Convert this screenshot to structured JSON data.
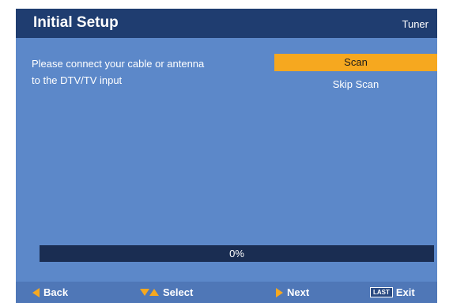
{
  "header": {
    "title": "Initial Setup",
    "section": "Tuner"
  },
  "main": {
    "instruction": "Please connect your cable or antenna to the DTV/TV input"
  },
  "menu": {
    "items": [
      {
        "label": "Scan",
        "selected": true
      },
      {
        "label": "Skip Scan",
        "selected": false
      }
    ]
  },
  "progress": {
    "value": 0,
    "label": "0%"
  },
  "footer": {
    "back_label": "Back",
    "select_label": "Select",
    "next_label": "Next",
    "exit_key": "LAST",
    "exit_label": "Exit"
  },
  "icons": {
    "back": "triangle-left-icon",
    "select": "triangle-down-up-icon",
    "next": "triangle-right-icon"
  },
  "colors": {
    "background": "#5c88c9",
    "header": "#1f3d70",
    "accent": "#f6a81f",
    "progress_track": "#1a2d52"
  }
}
